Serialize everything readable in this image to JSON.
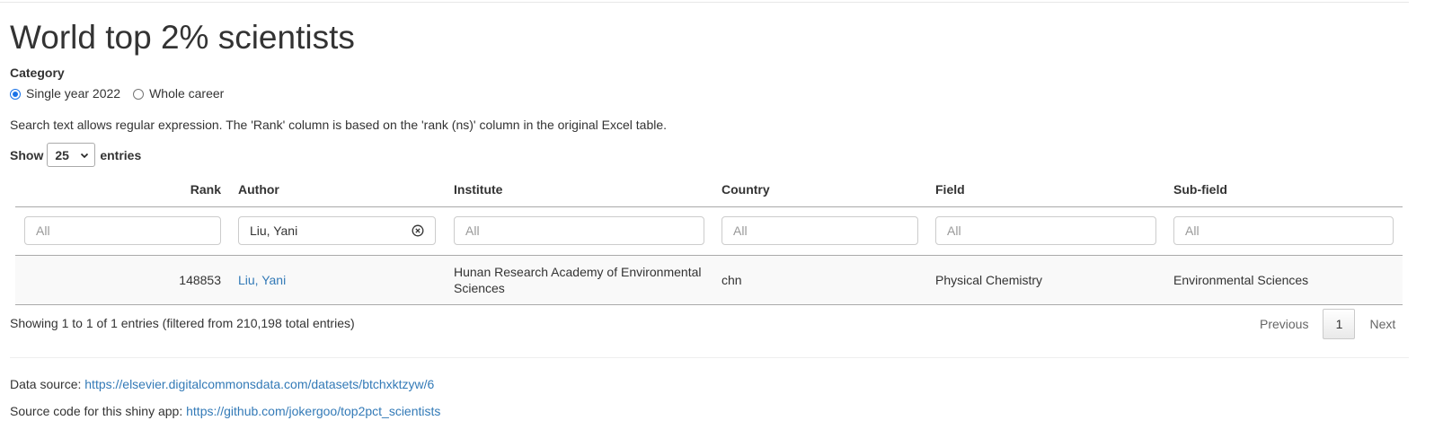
{
  "page": {
    "title": "World top 2% scientists"
  },
  "category": {
    "label": "Category",
    "options": [
      {
        "label": "Single year 2022",
        "checked": true
      },
      {
        "label": "Whole career",
        "checked": false
      }
    ]
  },
  "help_text": "Search text allows regular expression. The 'Rank' column is based on the 'rank (ns)' column in the original Excel table.",
  "length": {
    "show_label": "Show",
    "value": "25",
    "entries_label": "entries"
  },
  "table": {
    "columns": [
      "Rank",
      "Author",
      "Institute",
      "Country",
      "Field",
      "Sub-field"
    ],
    "filters": {
      "placeholder": "All",
      "author_value": "Liu, Yani"
    },
    "row": {
      "rank": "148853",
      "author": "Liu, Yani",
      "institute": "Hunan Research Academy of Environmental Sciences",
      "country": "chn",
      "field": "Physical Chemistry",
      "subfield": "Environmental Sciences"
    }
  },
  "info": "Showing 1 to 1 of 1 entries (filtered from 210,198 total entries)",
  "pagination": {
    "previous": "Previous",
    "current": "1",
    "next": "Next"
  },
  "footer": {
    "data_source_label": "Data source:",
    "data_source_url": "https://elsevier.digitalcommonsdata.com/datasets/btchxktzyw/6",
    "source_code_label": "Source code for this shiny app:",
    "source_code_url": "https://github.com/jokergoo/top2pct_scientists"
  },
  "colors": {
    "link": "#337ab7",
    "radio_accent": "#1a73e8",
    "row_background": "#f9f9f9"
  }
}
